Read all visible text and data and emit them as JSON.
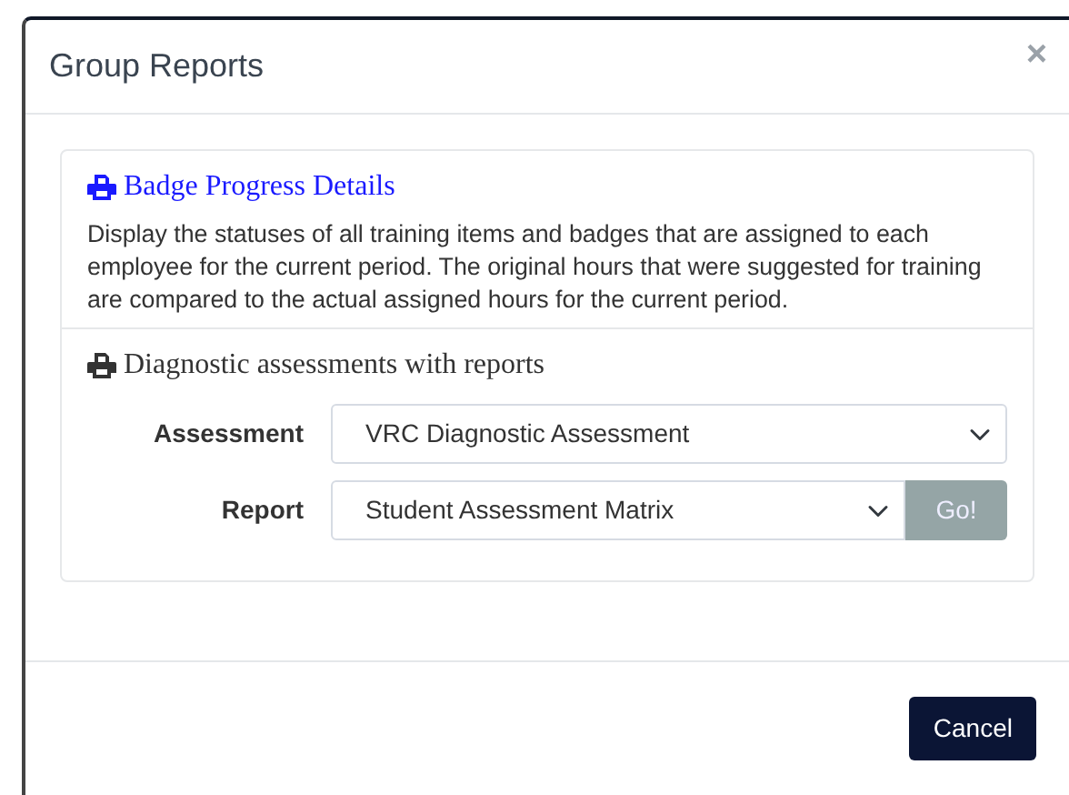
{
  "modal": {
    "title": "Group Reports",
    "close": "×"
  },
  "reports": [
    {
      "kind": "link",
      "title": "Badge Progress Details",
      "description": "Display the statuses of all training items and badges that are assigned to each employee for the current period. The original hours that were suggested for training are compared to the actual assigned hours for the current period."
    },
    {
      "kind": "form",
      "title": "Diagnostic assessments with reports",
      "fields": [
        {
          "label": "Assessment",
          "value": "VRC Diagnostic Assessment"
        },
        {
          "label": "Report",
          "value": "Student Assessment Matrix",
          "button": {
            "label": "Go!",
            "disabled": true
          }
        }
      ]
    }
  ],
  "footer": {
    "buttons": [
      "Cancel"
    ]
  }
}
